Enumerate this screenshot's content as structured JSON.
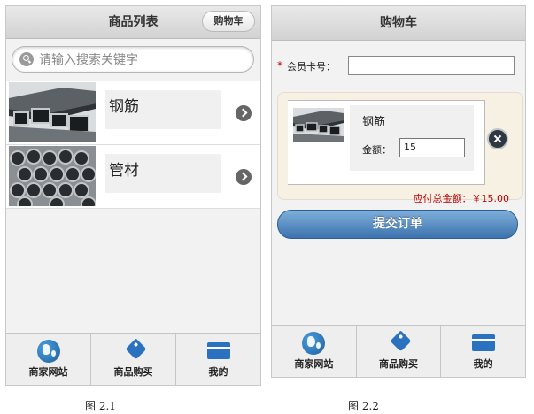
{
  "screen1": {
    "title": "商品列表",
    "cart_button": "购物车",
    "search_placeholder": "请输入搜索关键字",
    "items": [
      {
        "name": "钢筋",
        "thumb": "steel-square-tubes"
      },
      {
        "name": "管材",
        "thumb": "steel-round-pipes"
      }
    ],
    "tabs": [
      {
        "label": "商家网站",
        "icon": "globe-icon"
      },
      {
        "label": "商品购买",
        "icon": "tag-icon"
      },
      {
        "label": "我的",
        "icon": "card-icon"
      }
    ],
    "caption": "图 2.1"
  },
  "screen2": {
    "title": "购物车",
    "member_required": "*",
    "member_label": "会员卡号：",
    "member_value": "",
    "cart_item": {
      "name": "钢筋",
      "amount_label": "金额：",
      "amount_value": "15"
    },
    "total_label": "应付总金额：",
    "total_value": "￥15.00",
    "submit_label": "提交订单",
    "tabs": [
      {
        "label": "商家网站",
        "icon": "globe-icon"
      },
      {
        "label": "商品购买",
        "icon": "tag-icon"
      },
      {
        "label": "我的",
        "icon": "card-icon"
      }
    ],
    "caption": "图 2.2"
  },
  "colors": {
    "accent_blue": "#3c73ad",
    "price_red": "#c00000",
    "icon_blue": "#2a72c0"
  }
}
